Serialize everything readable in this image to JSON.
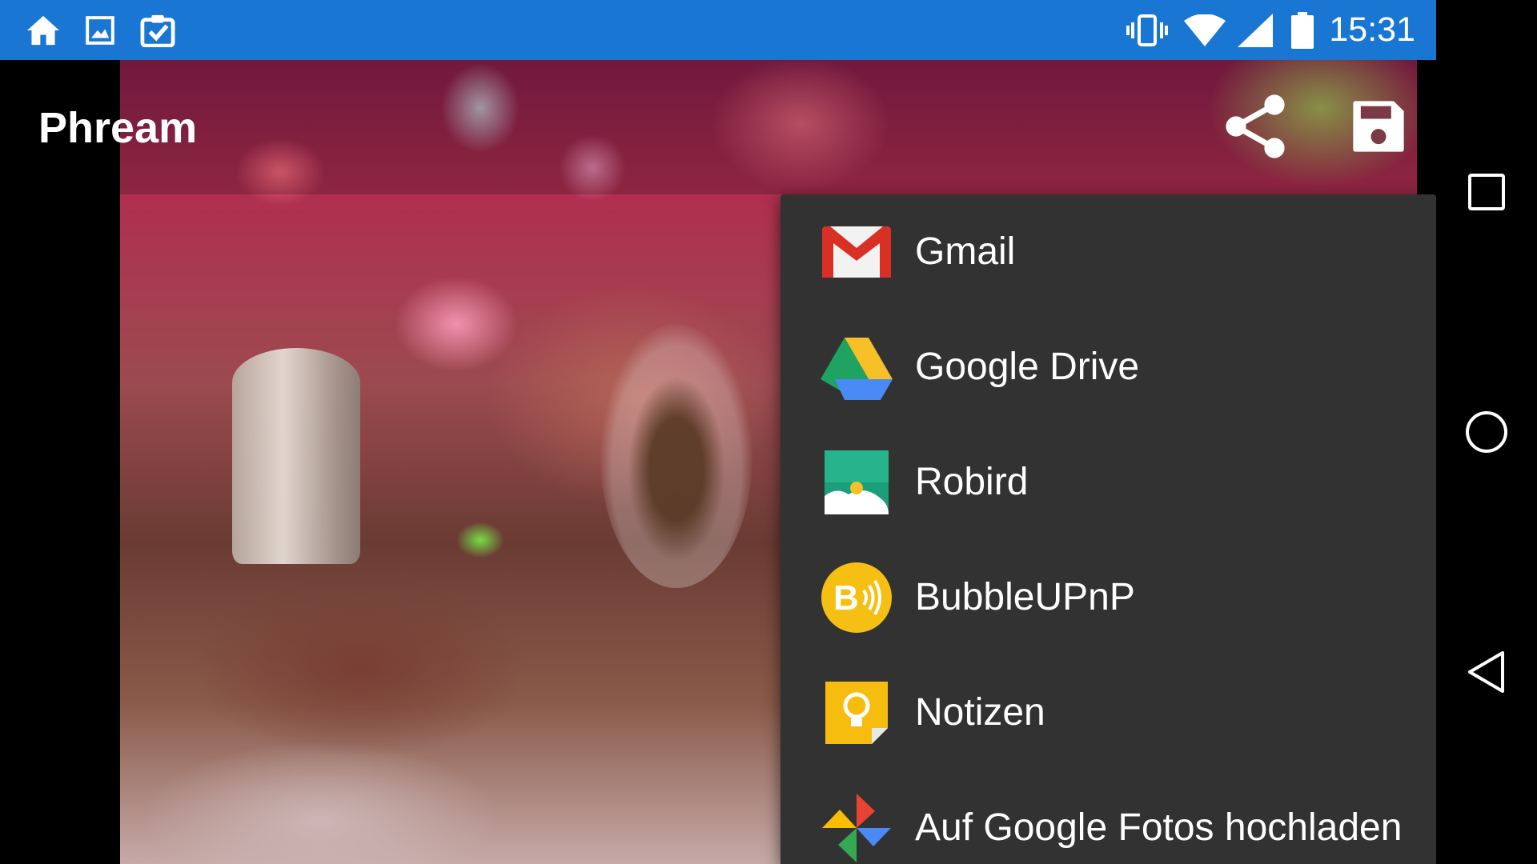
{
  "status_bar": {
    "time": "15:31",
    "left_icons": [
      "home-icon",
      "image-icon",
      "clipboard-check-icon"
    ],
    "right_icons": [
      "vibrate-icon",
      "wifi-icon",
      "signal-icon",
      "battery-icon"
    ],
    "background": "#1976d2"
  },
  "app_bar": {
    "title": "Phream",
    "actions": [
      "share-icon",
      "save-icon"
    ]
  },
  "share_menu": {
    "items": [
      {
        "label": "Gmail",
        "icon": "gmail-icon"
      },
      {
        "label": "Google Drive",
        "icon": "google-drive-icon"
      },
      {
        "label": "Robird",
        "icon": "robird-icon"
      },
      {
        "label": "BubbleUPnP",
        "icon": "bubbleupnp-icon"
      },
      {
        "label": "Notizen",
        "icon": "notizen-icon"
      },
      {
        "label": "Auf Google Fotos hochladen",
        "icon": "google-photos-icon"
      }
    ],
    "background": "#323232"
  },
  "nav_bar": {
    "buttons": [
      "recents-icon",
      "home-circle-icon",
      "back-icon"
    ]
  }
}
